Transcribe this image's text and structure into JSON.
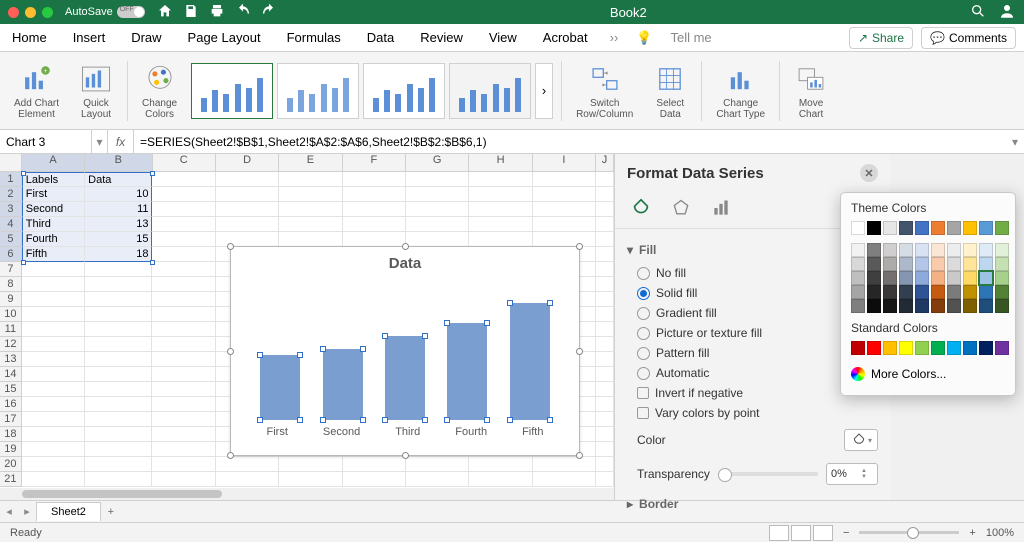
{
  "window": {
    "autosave_label": "AutoSave",
    "autosave_state": "OFF",
    "title": "Book2"
  },
  "ribbon_tabs": [
    "Home",
    "Insert",
    "Draw",
    "Page Layout",
    "Formulas",
    "Data",
    "Review",
    "View",
    "Acrobat"
  ],
  "tell_me": "Tell me",
  "share_label": "Share",
  "comments_label": "Comments",
  "ribbon_groups": {
    "add_chart_element": "Add Chart\nElement",
    "quick_layout": "Quick\nLayout",
    "change_colors": "Change\nColors",
    "switch": "Switch\nRow/Column",
    "select_data": "Select\nData",
    "change_type": "Change\nChart Type",
    "move_chart": "Move\nChart"
  },
  "namebox": "Chart 3",
  "formula": "=SERIES(Sheet2!$B$1,Sheet2!$A$2:$A$6,Sheet2!$B$2:$B$6,1)",
  "columns": [
    "A",
    "B",
    "C",
    "D",
    "E",
    "F",
    "G",
    "H",
    "I",
    "J"
  ],
  "table": {
    "headers": {
      "A": "Labels",
      "B": "Data"
    },
    "rows": [
      {
        "A": "First",
        "B": "10"
      },
      {
        "A": "Second",
        "B": "11"
      },
      {
        "A": "Third",
        "B": "13"
      },
      {
        "A": "Fourth",
        "B": "15"
      },
      {
        "A": "Fifth",
        "B": "18"
      }
    ]
  },
  "chart_data": {
    "type": "bar",
    "title": "Data",
    "categories": [
      "First",
      "Second",
      "Third",
      "Fourth",
      "Fifth"
    ],
    "values": [
      10,
      11,
      13,
      15,
      18
    ],
    "ylim": [
      0,
      20
    ],
    "series_name": "Data"
  },
  "pane": {
    "title": "Format Data Series",
    "fill_section": "Fill",
    "fill_options": [
      "No fill",
      "Solid fill",
      "Gradient fill",
      "Picture or texture fill",
      "Pattern fill",
      "Automatic"
    ],
    "fill_selected_index": 1,
    "invert_label": "Invert if negative",
    "vary_label": "Vary colors by point",
    "color_label": "Color",
    "transparency_label": "Transparency",
    "transparency_value": "0%",
    "border_section": "Border"
  },
  "color_popover": {
    "theme_title": "Theme Colors",
    "standard_title": "Standard Colors",
    "more_label": "More Colors...",
    "theme_row1": [
      "#ffffff",
      "#000000",
      "#e7e6e6",
      "#44546a",
      "#4472c4",
      "#ed7d31",
      "#a5a5a5",
      "#ffc000",
      "#5b9bd5",
      "#70ad47"
    ],
    "theme_shades": [
      [
        "#f2f2f2",
        "#7f7f7f",
        "#d0cece",
        "#d6dce4",
        "#d9e2f3",
        "#fbe5d5",
        "#ededed",
        "#fff2cc",
        "#deebf6",
        "#e2efd9"
      ],
      [
        "#d8d8d8",
        "#595959",
        "#aeabab",
        "#adb9ca",
        "#b4c6e7",
        "#f7cbac",
        "#dbdbdb",
        "#fee599",
        "#bdd7ee",
        "#c5e0b3"
      ],
      [
        "#bfbfbf",
        "#3f3f3f",
        "#757070",
        "#8496b0",
        "#8eaadb",
        "#f4b183",
        "#c9c9c9",
        "#ffd965",
        "#9cc3e5",
        "#a8d08d"
      ],
      [
        "#a5a5a5",
        "#262626",
        "#3a3838",
        "#323f4f",
        "#2f5496",
        "#c55a11",
        "#7b7b7b",
        "#bf9000",
        "#2e75b5",
        "#538135"
      ],
      [
        "#7f7f7f",
        "#0c0c0c",
        "#171616",
        "#222a35",
        "#1f3864",
        "#833c0b",
        "#525252",
        "#7f6000",
        "#1e4e79",
        "#375623"
      ]
    ],
    "standard": [
      "#c00000",
      "#ff0000",
      "#ffc000",
      "#ffff00",
      "#92d050",
      "#00b050",
      "#00b0f0",
      "#0070c0",
      "#002060",
      "#7030a0"
    ],
    "selected": "#9cc3e5"
  },
  "sheet_tab": "Sheet2",
  "status": "Ready",
  "zoom": "100%"
}
